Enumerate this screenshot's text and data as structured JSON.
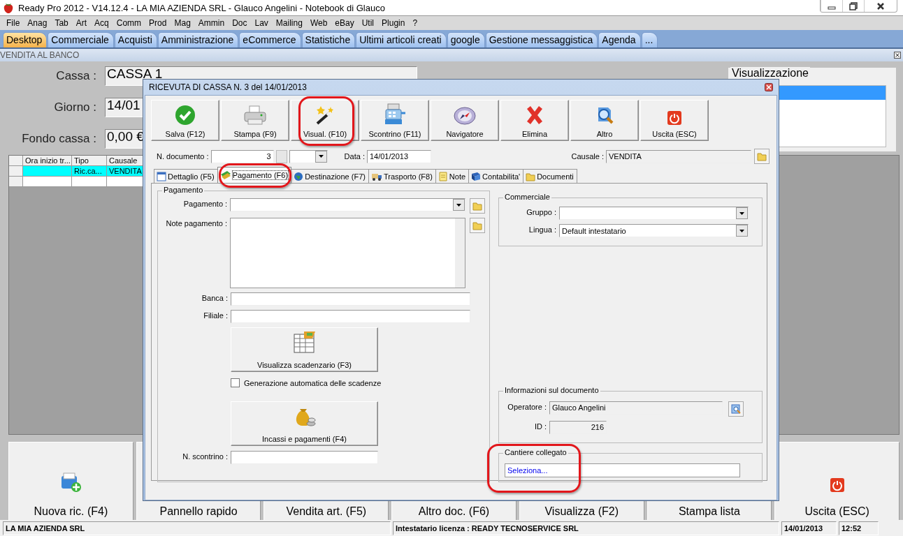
{
  "window": {
    "title": "Ready Pro 2012 - V14.12.4 - LA MIA AZIENDA SRL - Glauco Angelini - Notebook di Glauco"
  },
  "menu": [
    "File",
    "Anag",
    "Tab",
    "Art",
    "Acq",
    "Comm",
    "Prod",
    "Mag",
    "Ammin",
    "Doc",
    "Lav",
    "Mailing",
    "Web",
    "eBay",
    "Util",
    "Plugin",
    "?"
  ],
  "tabs": [
    {
      "label": "Desktop",
      "selected": true
    },
    {
      "label": "Commerciale",
      "selected": false
    },
    {
      "label": "Acquisti",
      "selected": false
    },
    {
      "label": "Amministrazione",
      "selected": false
    },
    {
      "label": "eCommerce",
      "selected": false
    },
    {
      "label": "Statistiche",
      "selected": false
    },
    {
      "label": "Ultimi articoli creati",
      "selected": false
    },
    {
      "label": "google",
      "selected": false
    },
    {
      "label": "Gestione messaggistica",
      "selected": false
    },
    {
      "label": "Agenda",
      "selected": false
    },
    {
      "label": "...",
      "selected": false
    }
  ],
  "panel": {
    "title": "VENDITA AL BANCO",
    "fields": [
      {
        "label": "Cassa :",
        "value": "CASSA 1"
      },
      {
        "label": "Giorno :",
        "value": "14/01"
      },
      {
        "label": "Fondo cassa :",
        "value": "0,00 €"
      }
    ],
    "view_group": {
      "title": "Visualizzazione",
      "rows": [
        {
          "selected": true
        },
        {
          "selected": false
        }
      ]
    },
    "grid": {
      "columns": [
        "Ora inizio tr...",
        "Tipo",
        "Causale"
      ],
      "rows": [
        {
          "cells": [
            "",
            "Ric.ca...",
            "VENDITA"
          ],
          "selected": true
        },
        {
          "cells": [
            "",
            "",
            ""
          ],
          "selected": false
        }
      ]
    },
    "buttons": [
      {
        "label": "Nuova ric. (F4)"
      },
      {
        "label": "Pannello rapido"
      },
      {
        "label": "Vendita art. (F5)"
      },
      {
        "label": "Altro doc. (F6)"
      },
      {
        "label": "Visualizza (F2)"
      },
      {
        "label": "Stampa lista"
      },
      {
        "label": "Uscita (ESC)"
      }
    ]
  },
  "dialog": {
    "title": "RICEVUTA DI CASSA N. 3  del 14/01/2013",
    "toolbar": [
      {
        "label": "Salva (F12)",
        "highlighted": false
      },
      {
        "label": "Stampa (F9)",
        "highlighted": false
      },
      {
        "label": "Visual. (F10)",
        "highlighted": true
      },
      {
        "label": "Scontrino (F11)",
        "highlighted": false
      },
      {
        "label": "Navigatore",
        "highlighted": false
      },
      {
        "label": "Elimina",
        "highlighted": false
      },
      {
        "label": "Altro",
        "highlighted": false
      },
      {
        "label": "Uscita (ESC)",
        "highlighted": false
      }
    ],
    "doc_number": {
      "label": "N. documento :",
      "value": "3"
    },
    "date": {
      "label": "Data :",
      "value": "14/01/2013"
    },
    "causale": {
      "label": "Causale :",
      "value": "VENDITA"
    },
    "tabs": [
      {
        "label": "Dettaglio (F5)",
        "selected": false,
        "highlighted": false
      },
      {
        "label": "Pagamento (F6)",
        "selected": true,
        "highlighted": true
      },
      {
        "label": "Destinazione (F7)",
        "selected": false,
        "highlighted": false
      },
      {
        "label": "Trasporto (F8)",
        "selected": false,
        "highlighted": false
      },
      {
        "label": "Note",
        "selected": false,
        "highlighted": false
      },
      {
        "label": "Contabilita'",
        "selected": false,
        "highlighted": false
      },
      {
        "label": "Documenti",
        "selected": false,
        "highlighted": false
      }
    ],
    "payment": {
      "title": "Pagamento",
      "pagamento_label": "Pagamento :",
      "notes_label": "Note pagamento :",
      "bank_label": "Banca :",
      "branch_label": "Filiale :",
      "schedule_button": "Visualizza scadenzario (F3)",
      "auto_schedule": {
        "label": "Generazione automatica delle scadenze",
        "checked": false
      },
      "payments_button": "Incassi e pagamenti (F4)",
      "receipt_label": "N. scontrino :"
    },
    "commercial": {
      "title": "Commerciale",
      "group_label": "Gruppo :",
      "language_label": "Lingua :",
      "language": "Default intestatario"
    },
    "info": {
      "title": "Informazioni sul documento",
      "operator_label": "Operatore :",
      "operator": "Glauco Angelini",
      "id_label": "ID :",
      "id": "216"
    },
    "site": {
      "title": "Cantiere collegato",
      "placeholder": "Seleziona...",
      "highlighted": true
    }
  },
  "status_bar": [
    "LA MIA AZIENDA SRL",
    "Intestatario licenza : READY TECNOSERVICE SRL",
    "14/01/2013",
    "12:52"
  ]
}
